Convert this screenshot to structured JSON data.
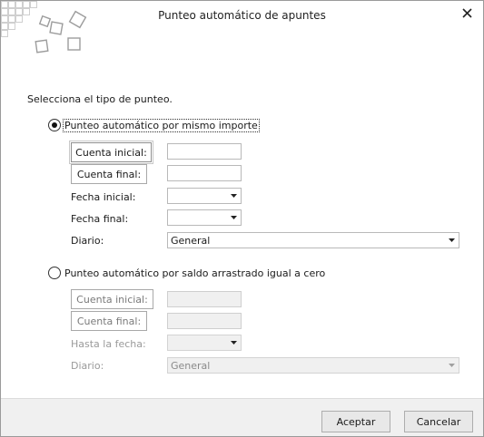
{
  "window": {
    "title": "Punteo automático de apuntes",
    "close_icon": "close-icon"
  },
  "prompt": "Selecciona el tipo de punteo.",
  "option1": {
    "label": "Punteo automático por mismo importe",
    "selected": true,
    "cuenta_inicial_label": "Cuenta inicial:",
    "cuenta_inicial_value": "",
    "cuenta_final_label": "Cuenta final:",
    "cuenta_final_value": "",
    "fecha_inicial_label": "Fecha inicial:",
    "fecha_inicial_value": "",
    "fecha_final_label": "Fecha final:",
    "fecha_final_value": "",
    "diario_label": "Diario:",
    "diario_value": "General"
  },
  "option2": {
    "label": "Punteo automático por saldo arrastrado igual a cero",
    "selected": false,
    "cuenta_inicial_label": "Cuenta inicial:",
    "cuenta_inicial_value": "",
    "cuenta_final_label": "Cuenta final:",
    "cuenta_final_value": "",
    "hasta_fecha_label": "Hasta la fecha:",
    "hasta_fecha_value": "",
    "diario_label": "Diario:",
    "diario_value": "General"
  },
  "footer": {
    "accept_label": "Aceptar",
    "cancel_label": "Cancelar"
  }
}
